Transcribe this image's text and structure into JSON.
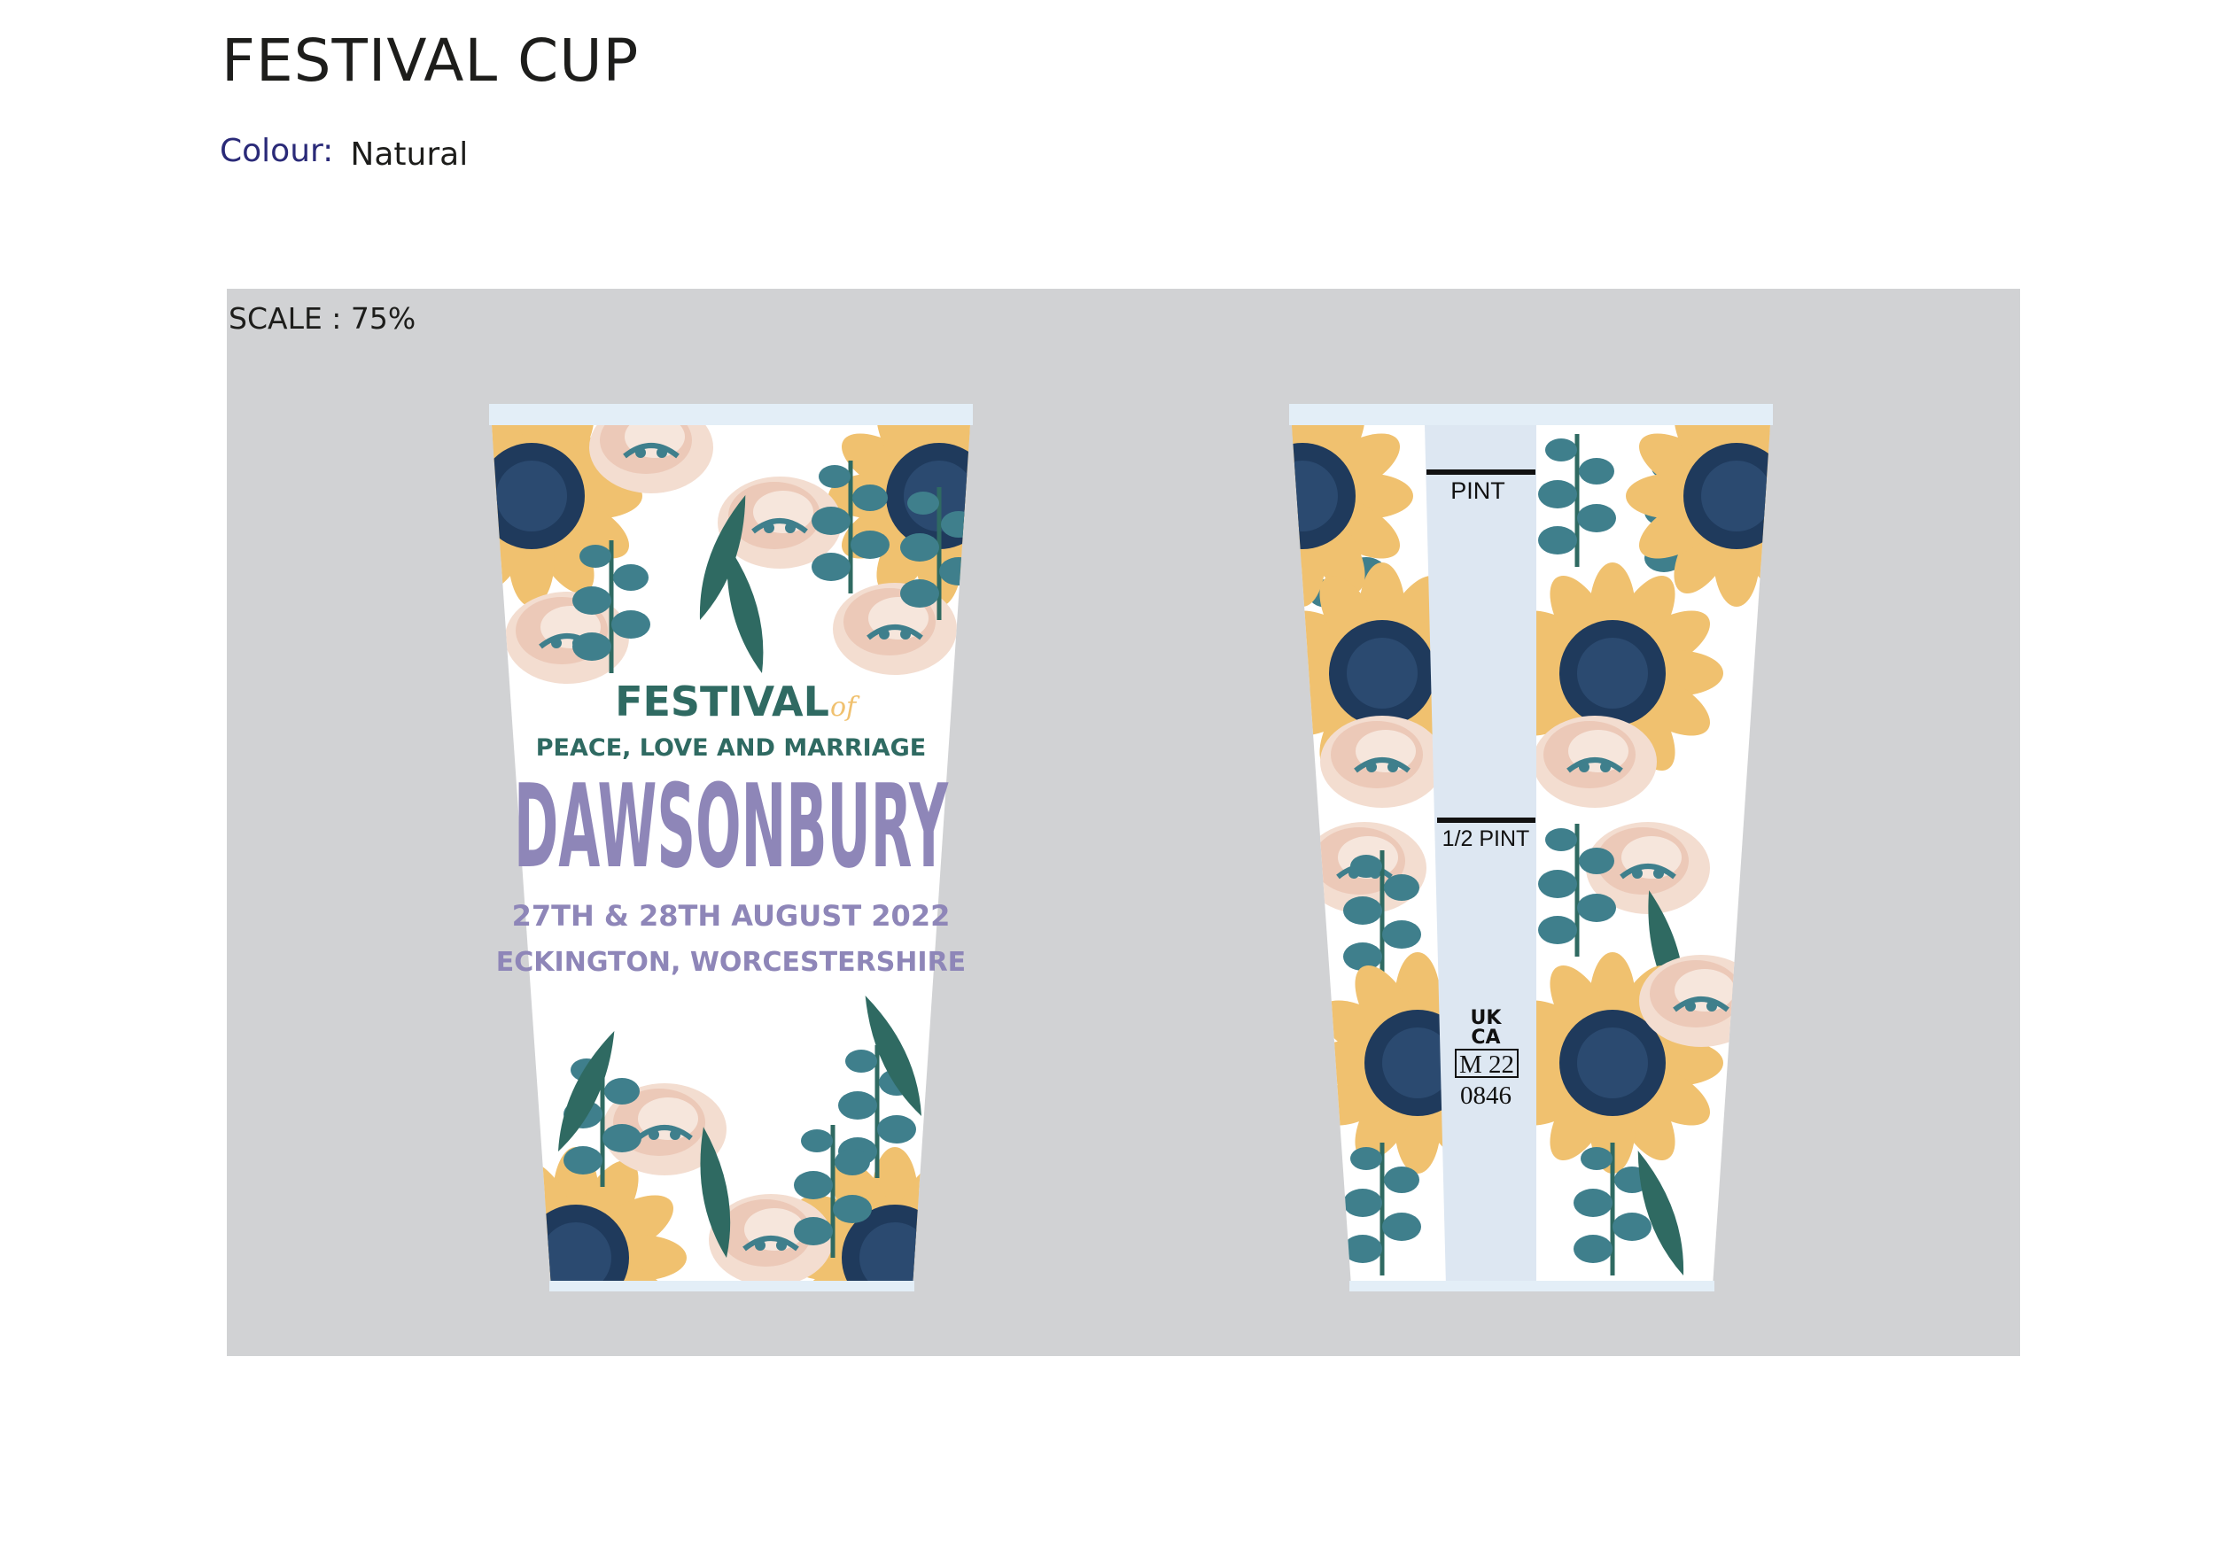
{
  "title": "FESTIVAL CUP",
  "colour": {
    "label": "Colour:",
    "value": "Natural"
  },
  "scale": "SCALE : 75%",
  "front_print": {
    "line1": "FESTIVAL",
    "line1_script": "of",
    "line2": "PEACE, LOVE AND MARRIAGE",
    "name": "DAWSONBURY",
    "date": "27TH & 28TH AUGUST 2022",
    "location": "ECKINGTON, WORCESTERSHIRE"
  },
  "back_print": {
    "pint_label": "PINT",
    "half_pint_label": "1/2 PINT",
    "mark_top": "UK",
    "mark_bottom": "CA",
    "metrology": "M 22",
    "cert_number": "0846"
  },
  "colors": {
    "panel": "#d1d2d4",
    "navy": "#1f3a5c",
    "mustard": "#f0c16f",
    "teal": "#3f7f8c",
    "dark_green": "#2f6a62",
    "blush": "#f3ddd0",
    "lavender": "#8e86b8",
    "rim": "#e3eef7"
  }
}
